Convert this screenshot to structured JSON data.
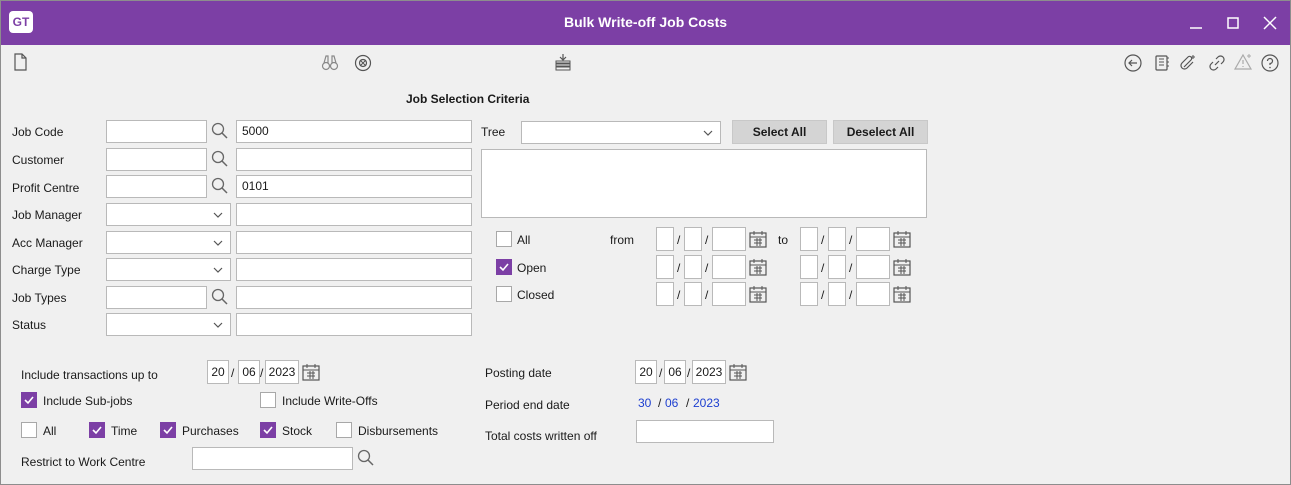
{
  "window": {
    "app_logo": "GT",
    "title": "Bulk Write-off Job Costs"
  },
  "icons": {
    "new": "document-icon",
    "find": "binoculars-icon",
    "refresh": "cycle-icon",
    "process": "stack-icon",
    "back": "circle-left-arrow-icon",
    "notes": "notebook-icon",
    "attach": "paperclip-icon",
    "link": "link-icon",
    "alert": "warning-icon",
    "help": "help-icon"
  },
  "selection": {
    "heading": "Job Selection Criteria",
    "job_code": {
      "label": "Job Code",
      "value": "",
      "description": "5000"
    },
    "customer": {
      "label": "Customer",
      "value": "",
      "description": ""
    },
    "profit_centre": {
      "label": "Profit Centre",
      "value": "",
      "description": "0101"
    },
    "job_manager": {
      "label": "Job Manager",
      "value": "",
      "description": ""
    },
    "acc_manager": {
      "label": "Acc Manager",
      "value": "",
      "description": ""
    },
    "charge_type": {
      "label": "Charge Type",
      "value": "",
      "description": ""
    },
    "job_types": {
      "label": "Job Types",
      "value": "",
      "description": ""
    },
    "status": {
      "label": "Status",
      "value": "",
      "description": ""
    },
    "tree": {
      "label": "Tree",
      "value": ""
    },
    "select_all": "Select All",
    "deselect_all": "Deselect All",
    "status_filters": [
      {
        "label": "All",
        "checked": false
      },
      {
        "label": "Open",
        "checked": true
      },
      {
        "label": "Closed",
        "checked": false
      }
    ],
    "from_label": "from",
    "to_label": "to"
  },
  "options": {
    "include_up_to": {
      "label": "Include transactions up to",
      "day": "20",
      "month": "06",
      "year": "2023"
    },
    "include_subjobs": {
      "label": "Include Sub-jobs",
      "checked": true
    },
    "include_writeoffs": {
      "label": "Include Write-Offs",
      "checked": false
    },
    "types": [
      {
        "label": "All",
        "checked": false
      },
      {
        "label": "Time",
        "checked": true
      },
      {
        "label": "Purchases",
        "checked": true
      },
      {
        "label": "Stock",
        "checked": true
      },
      {
        "label": "Disbursements",
        "checked": false
      }
    ],
    "restrict_work_centre": {
      "label": "Restrict to Work Centre",
      "value": ""
    }
  },
  "posting": {
    "posting_date": {
      "label": "Posting date",
      "day": "20",
      "month": "06",
      "year": "2023"
    },
    "period_end": {
      "label": "Period end date",
      "day": "30",
      "month": "06",
      "year": "2023"
    },
    "total_costs": {
      "label": "Total costs written off",
      "value": ""
    }
  },
  "colors": {
    "accent": "#7c3fa5",
    "link_blue": "#1d3fd0"
  }
}
